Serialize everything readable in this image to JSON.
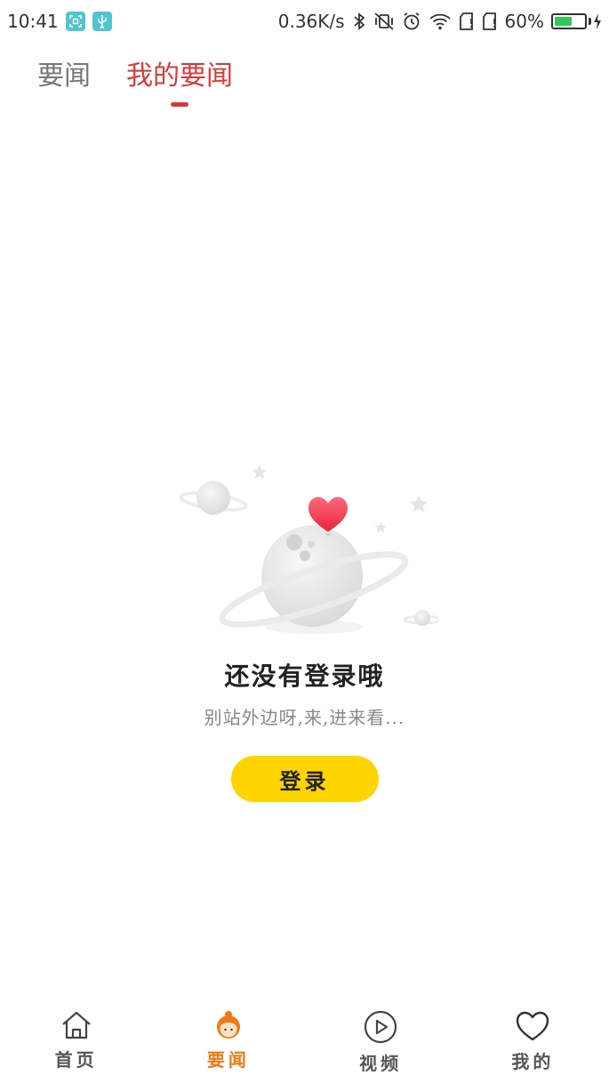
{
  "status_bar": {
    "time": "10:41",
    "left_icons": [
      "screenshot-icon",
      "usb-icon"
    ],
    "net_speed": "0.36K/s",
    "right_icons": [
      "bluetooth-icon",
      "vibrate-off-icon",
      "alarm-icon",
      "wifi-icon",
      "sim1-icon",
      "sim2-icon"
    ],
    "battery_percent": "60%",
    "battery_level": 0.6,
    "battery_color": "#35c759"
  },
  "tabs": [
    {
      "label": "要闻",
      "active": false
    },
    {
      "label": "我的要闻",
      "active": true
    }
  ],
  "accent_color": "#d63b3b",
  "empty_state": {
    "illustration": "planet-heart-illustration",
    "title": "还没有登录哦",
    "subtitle": "别站外边呀,来,进来看...",
    "button_label": "登录",
    "button_color": "#ffd500"
  },
  "bottom_nav": [
    {
      "label": "首页",
      "icon": "home-icon",
      "active": false
    },
    {
      "label": "要闻",
      "icon": "avatar-girl-icon",
      "active": true
    },
    {
      "label": "视频",
      "icon": "play-icon",
      "active": false
    },
    {
      "label": "我的",
      "icon": "heart-icon",
      "active": false
    }
  ],
  "nav_active_color": "#f07a14"
}
